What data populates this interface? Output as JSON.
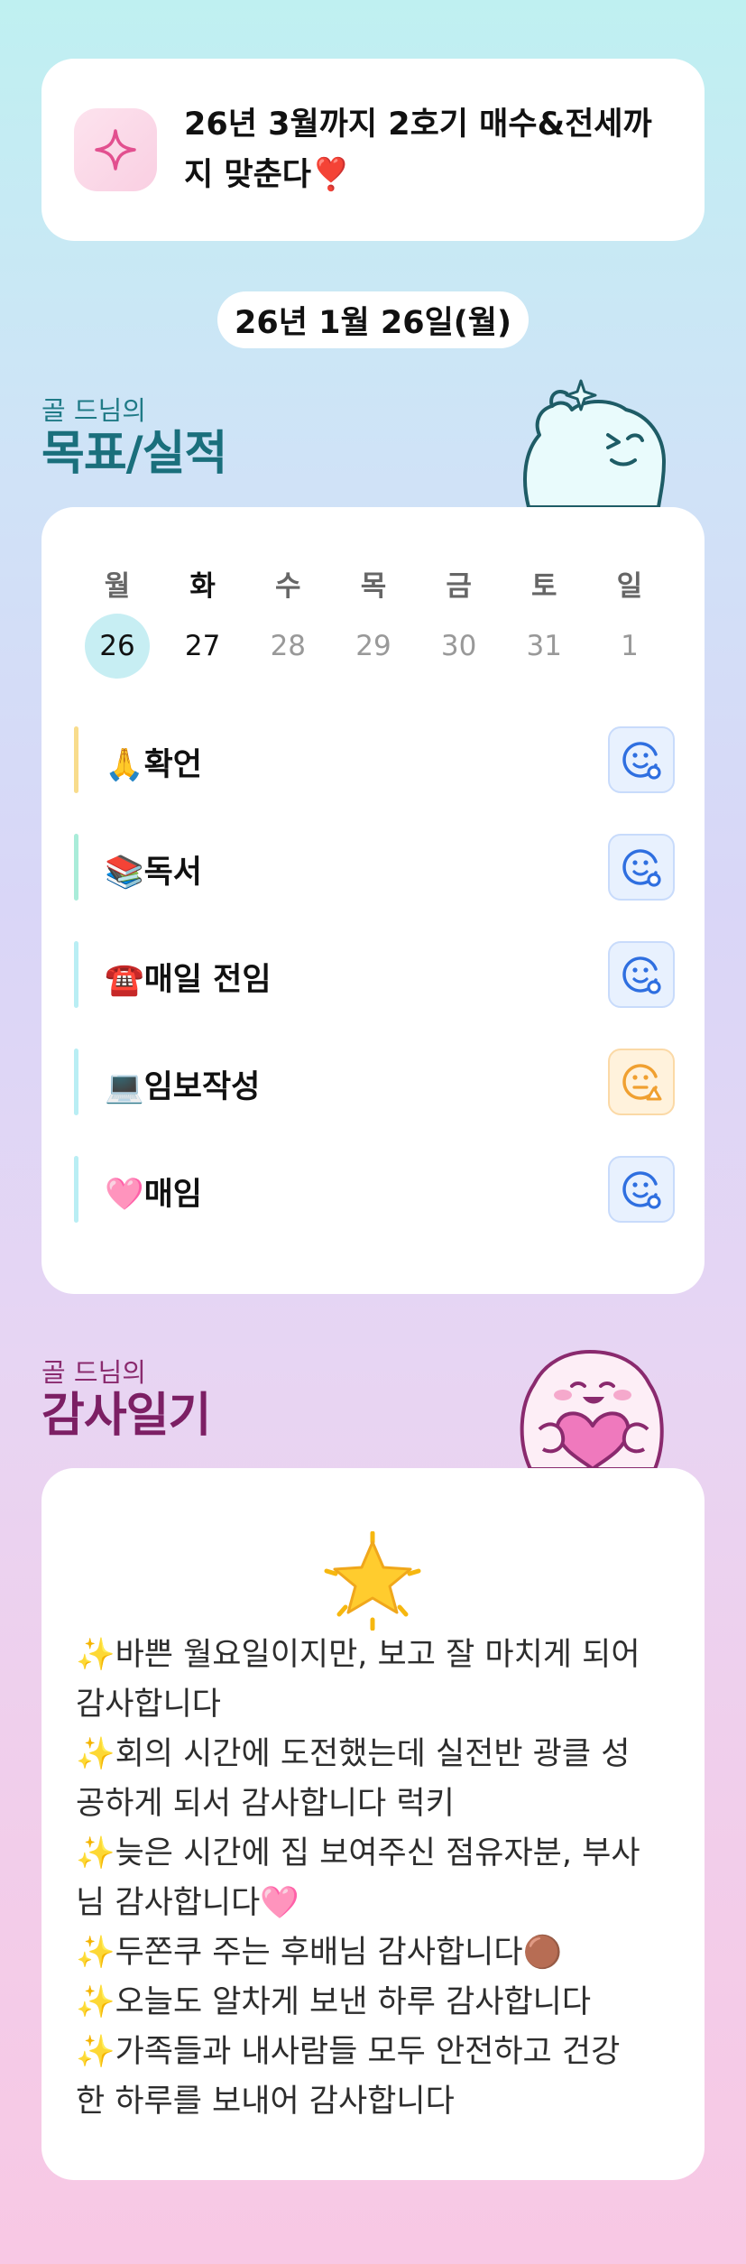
{
  "goal": {
    "line1": "26년 3월까지 2호기 매수&전세까",
    "line2": "지 맞춘다❣️"
  },
  "date_label": "26년 1월 26일(월)",
  "goals_section": {
    "subtitle": "골 드님의",
    "title": "목표/실적"
  },
  "week": {
    "days": [
      "월",
      "화",
      "수",
      "목",
      "금",
      "토",
      "일"
    ],
    "dates": [
      "26",
      "27",
      "28",
      "29",
      "30",
      "31",
      "1"
    ],
    "selected_index": 0,
    "today_index": 1
  },
  "habits": [
    {
      "label": "🙏확언",
      "status": "done",
      "accent": "#f8dc8c"
    },
    {
      "label": "📚독서",
      "status": "done",
      "accent": "#a9ecd9"
    },
    {
      "label": "☎️매일 전임",
      "status": "done",
      "accent": "#b9eef4"
    },
    {
      "label": "💻임보작성",
      "status": "pending",
      "accent": "#b9eef4"
    },
    {
      "label": "🩷매임",
      "status": "done",
      "accent": "#b9eef4"
    }
  ],
  "thanks_section": {
    "subtitle": "골 드님의",
    "title": "감사일기"
  },
  "thanks": {
    "lines": [
      "✨바쁜 월요일이지만, 보고 잘 마치게 되어",
      "감사합니다",
      "✨회의 시간에 도전했는데 실전반 광클 성",
      "공하게 되서 감사합니다 럭키",
      "✨늦은 시간에 집 보여주신 점유자분, 부사",
      "님 감사합니다🩷",
      "✨두쫀쿠 주는 후배님 감사합니다🟤",
      "✨오늘도 알차게 보낸 하루 감사합니다",
      "✨가족들과 내사람들 모두 안전하고 건강",
      "한 하루를 보내어 감사합니다"
    ]
  },
  "colors": {
    "teal_title": "#1a6f7c",
    "plum_title": "#7c1f64",
    "done_icon": "#2f6fe0",
    "pending_icon": "#f0a030"
  }
}
